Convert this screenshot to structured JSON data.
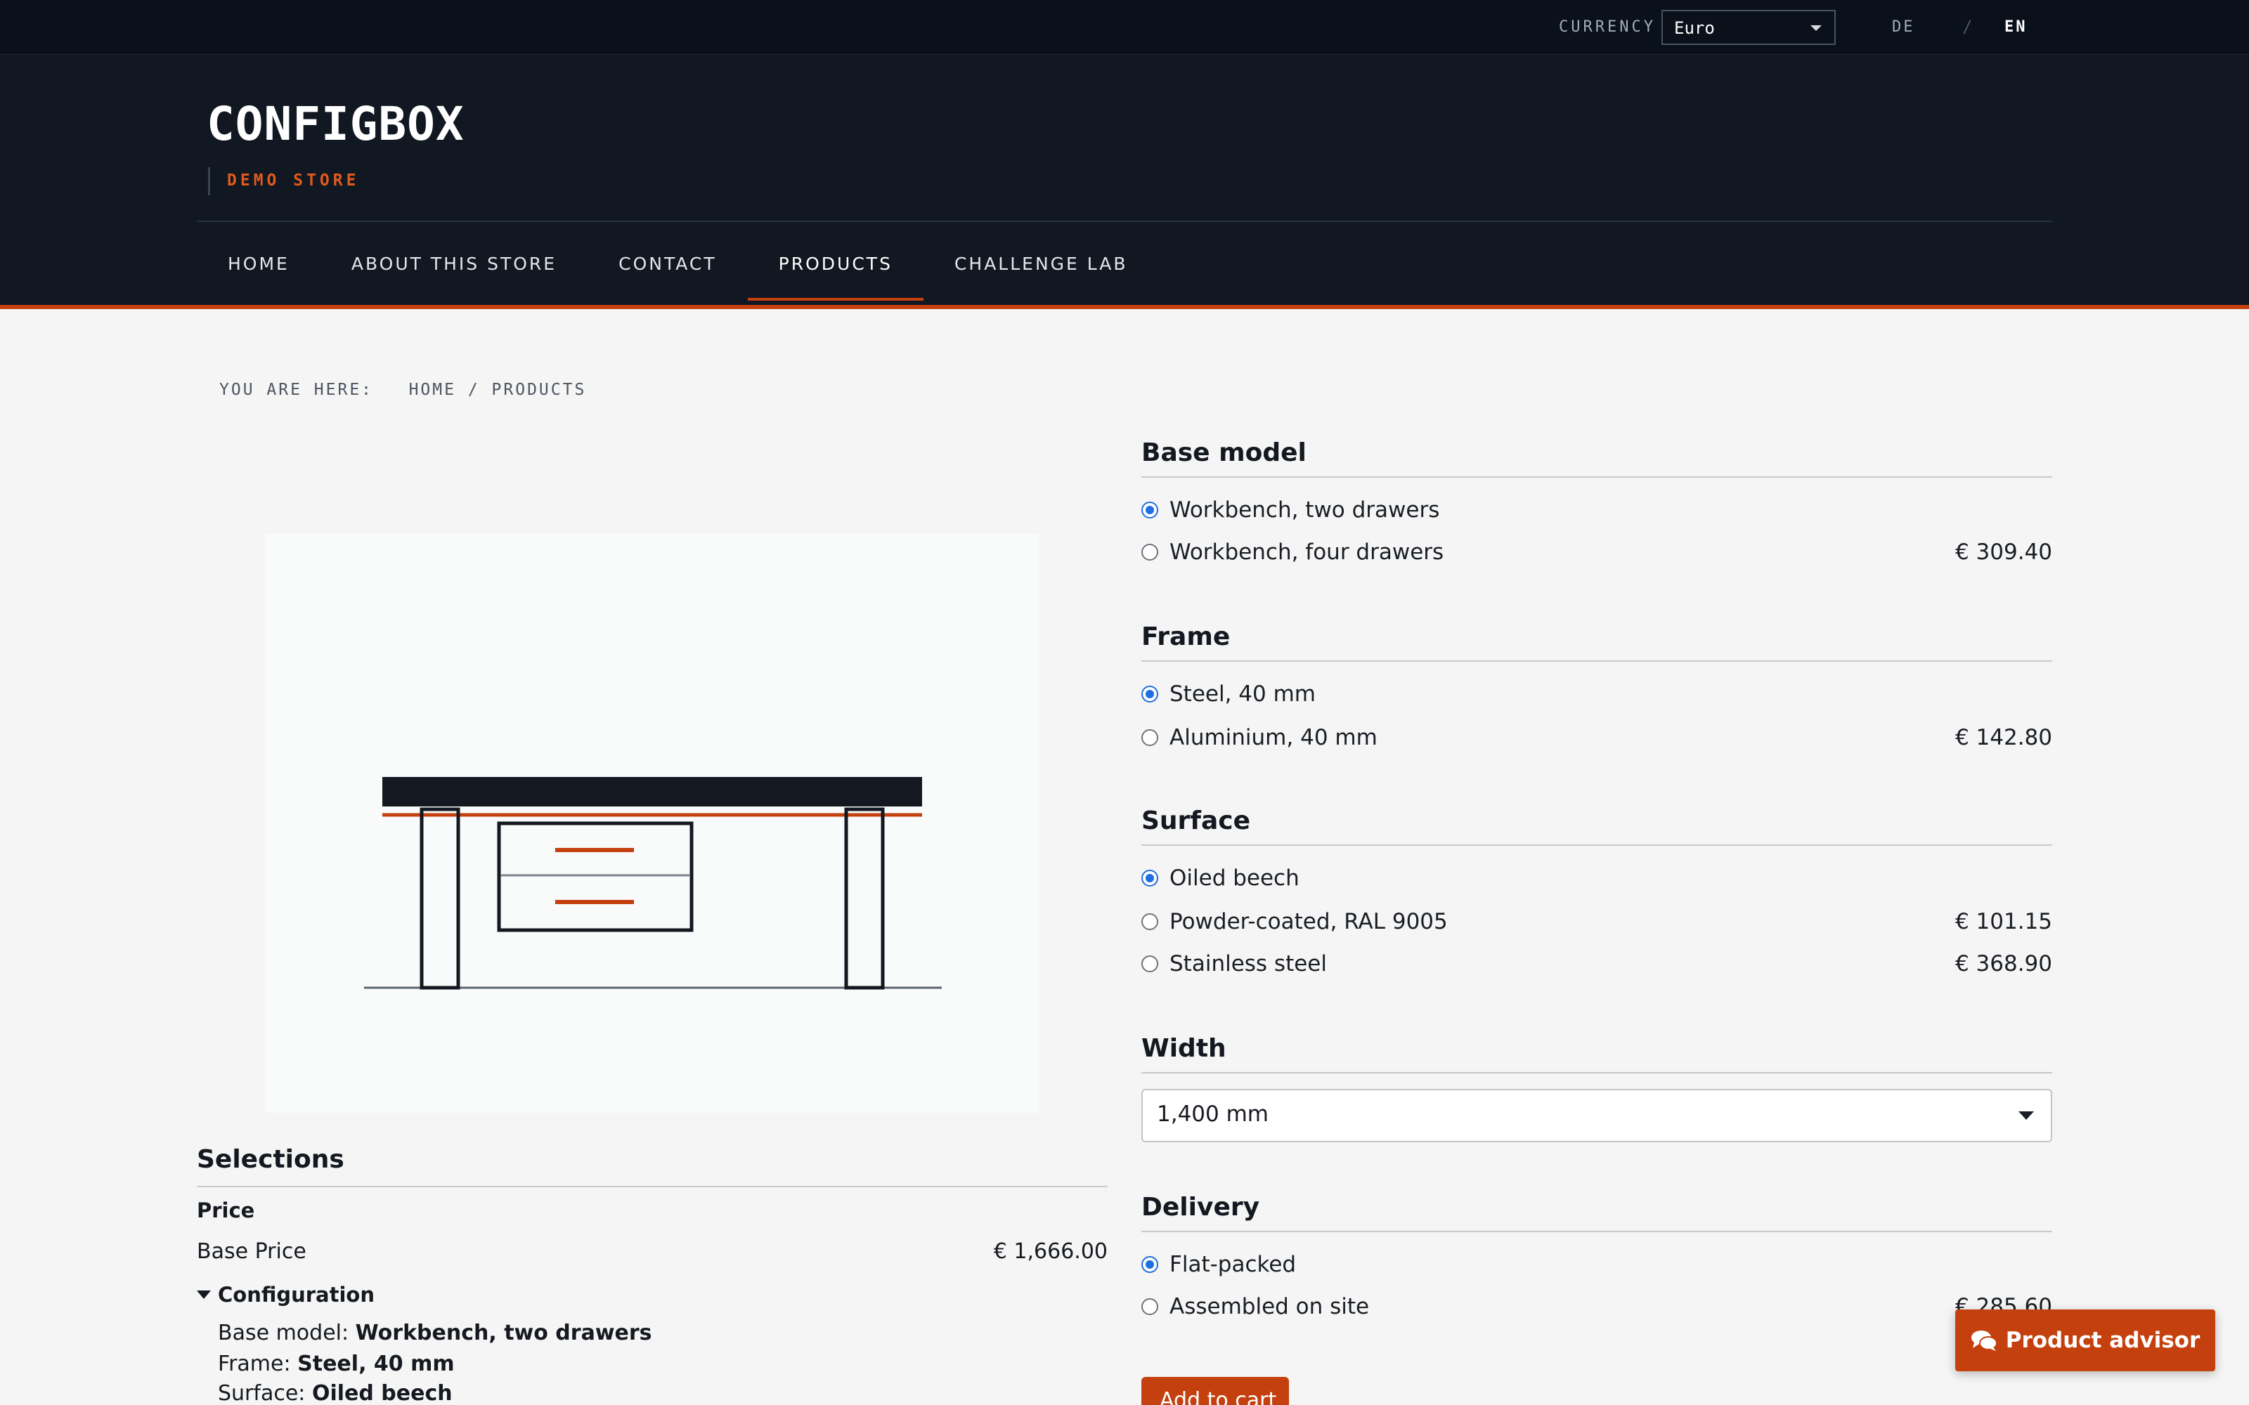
{
  "topbar": {
    "currency_label": "CURRENCY",
    "currency_value": "Euro",
    "lang_de": "DE",
    "lang_separator": "/",
    "lang_en": "EN"
  },
  "header": {
    "brand": "CONFIGBOX",
    "tagline": "DEMO STORE",
    "nav": [
      "HOME",
      "ABOUT THIS STORE",
      "CONTACT",
      "PRODUCTS",
      "CHALLENGE LAB"
    ],
    "active_nav": "PRODUCTS"
  },
  "breadcrumb": {
    "prefix": "YOU ARE HERE:",
    "home": "HOME",
    "separator": "/",
    "current": "PRODUCTS"
  },
  "product_image": {
    "icon": "workbench-illustration",
    "accent_color": "#c4410f",
    "ink_color": "#141820"
  },
  "selections": {
    "title": "Selections",
    "price_heading": "Price",
    "base_price_label": "Base Price",
    "base_price_value": "€ 1,666.00",
    "configuration_heading": "Configuration",
    "lines": [
      {
        "label": "Base model:",
        "value": "Workbench, two drawers"
      },
      {
        "label": "Frame:",
        "value": "Steel, 40 mm"
      },
      {
        "label": "Surface:",
        "value": "Oiled beech"
      }
    ]
  },
  "options": {
    "base_model": {
      "title": "Base model",
      "items": [
        {
          "label": "Workbench, two drawers",
          "price": "",
          "selected": true
        },
        {
          "label": "Workbench, four drawers",
          "price": "€ 309.40",
          "selected": false
        }
      ]
    },
    "frame": {
      "title": "Frame",
      "items": [
        {
          "label": "Steel, 40 mm",
          "price": "",
          "selected": true
        },
        {
          "label": "Aluminium, 40 mm",
          "price": "€ 142.80",
          "selected": false
        }
      ]
    },
    "surface": {
      "title": "Surface",
      "items": [
        {
          "label": "Oiled beech",
          "price": "",
          "selected": true
        },
        {
          "label": "Powder-coated, RAL 9005",
          "price": "€ 101.15",
          "selected": false
        },
        {
          "label": "Stainless steel",
          "price": "€ 368.90",
          "selected": false
        }
      ]
    },
    "width": {
      "title": "Width",
      "value": "1,400 mm"
    },
    "delivery": {
      "title": "Delivery",
      "items": [
        {
          "label": "Flat-packed",
          "price": "",
          "selected": true
        },
        {
          "label": "Assembled on site",
          "price": "€ 285.60",
          "selected": false
        }
      ]
    }
  },
  "actions": {
    "add_to_cart": "Add to cart",
    "product_advisor": "Product advisor"
  },
  "colors": {
    "accent": "#c4410f",
    "header_bg": "#111821",
    "topbar_bg": "#0b111b",
    "radio_selected": "#1e6fe0"
  }
}
